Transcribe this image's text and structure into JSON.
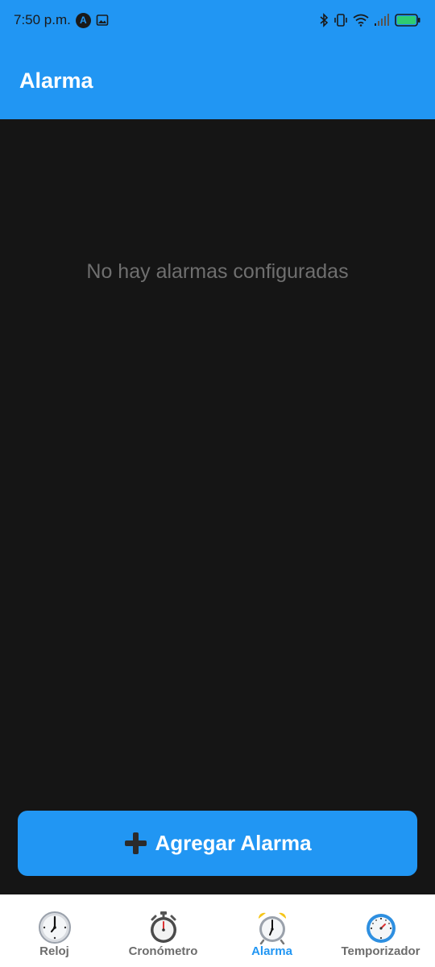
{
  "status_bar": {
    "time": "7:50 p.m.",
    "app_icon_letter": "A"
  },
  "app_bar": {
    "title": "Alarma"
  },
  "main": {
    "empty_message": "No hay alarmas configuradas"
  },
  "add_button": {
    "label": "Agregar Alarma",
    "icon": "plus-icon"
  },
  "bottom_nav": {
    "items": [
      {
        "label": "Reloj",
        "icon": "clock-icon",
        "active": false
      },
      {
        "label": "Cronómetro",
        "icon": "stopwatch-icon",
        "active": false
      },
      {
        "label": "Alarma",
        "icon": "alarm-clock-icon",
        "active": true
      },
      {
        "label": "Temporizador",
        "icon": "timer-icon",
        "active": false
      }
    ]
  },
  "colors": {
    "primary": "#2196f3",
    "background": "#151515",
    "empty_text": "#6f6f6f",
    "nav_inactive": "#6d6d6d"
  }
}
